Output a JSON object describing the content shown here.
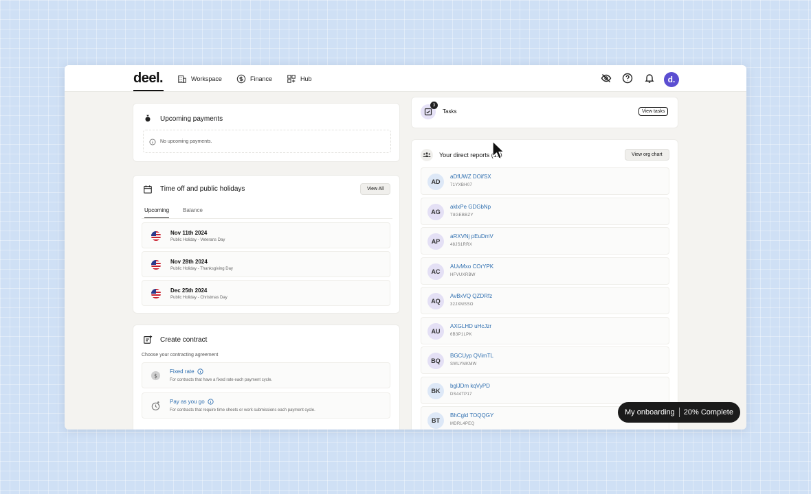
{
  "nav": {
    "logo": "deel.",
    "items": [
      {
        "label": "Workspace",
        "icon": "building-icon"
      },
      {
        "label": "Finance",
        "icon": "dollar-circle-icon"
      },
      {
        "label": "Hub",
        "icon": "grid-plus-icon"
      }
    ],
    "avatar_letter": "d."
  },
  "payments": {
    "title": "Upcoming payments",
    "empty": "No upcoming payments."
  },
  "timeoff": {
    "title": "Time off and public holidays",
    "view_all": "View All",
    "tabs": [
      "Upcoming",
      "Balance"
    ],
    "holidays": [
      {
        "date": "Nov 11th 2024",
        "desc": "Public Holiday - Veterans Day"
      },
      {
        "date": "Nov 28th 2024",
        "desc": "Public Holiday - Thanksgiving Day"
      },
      {
        "date": "Dec 25th 2024",
        "desc": "Public Holiday - Christmas Day"
      }
    ]
  },
  "contract": {
    "title": "Create contract",
    "subtitle": "Choose your contracting agreement",
    "options": [
      {
        "title": "Fixed rate",
        "desc": "For contracts that have a fixed rate each payment cycle."
      },
      {
        "title": "Pay as you go",
        "desc": "For contracts that require time sheets or work submissions each payment cycle."
      }
    ]
  },
  "tasks": {
    "title": "Tasks",
    "badge": "3",
    "button": "View tasks"
  },
  "reports": {
    "title": "Your direct reports (13)",
    "button": "View org chart",
    "items": [
      {
        "initials": "AD",
        "name": "aDfUWZ DOifSX",
        "code": "71YXBH07",
        "color": "#dde8f7"
      },
      {
        "initials": "AG",
        "name": "aklxPe GDGbNp",
        "code": "T8GEBBZY",
        "color": "#e4e0f5"
      },
      {
        "initials": "AP",
        "name": "aRXVNj pEuDmV",
        "code": "48JS1RRX",
        "color": "#e4e0f5"
      },
      {
        "initials": "AC",
        "name": "AUvMxo COrYPK",
        "code": "HFVUXRBW",
        "color": "#e4e0f5"
      },
      {
        "initials": "AQ",
        "name": "AvBxVQ QZDRfz",
        "code": "32JXMSSO",
        "color": "#e4e0f5"
      },
      {
        "initials": "AU",
        "name": "AXGLHD uHcJzr",
        "code": "6B3P1LPK",
        "color": "#e4e0f5"
      },
      {
        "initials": "BQ",
        "name": "BGCUyp QVimTL",
        "code": "SWLYMKMW",
        "color": "#e4e0f5"
      },
      {
        "initials": "BK",
        "name": "bglJDm kqVyPD",
        "code": "DS44TP17",
        "color": "#dde8f7"
      },
      {
        "initials": "BT",
        "name": "BhCgld TOQQGY",
        "code": "MDRL4PEQ",
        "color": "#dde8f7"
      }
    ]
  },
  "onboarding": {
    "label": "My onboarding",
    "progress_text": "20% Complete"
  }
}
